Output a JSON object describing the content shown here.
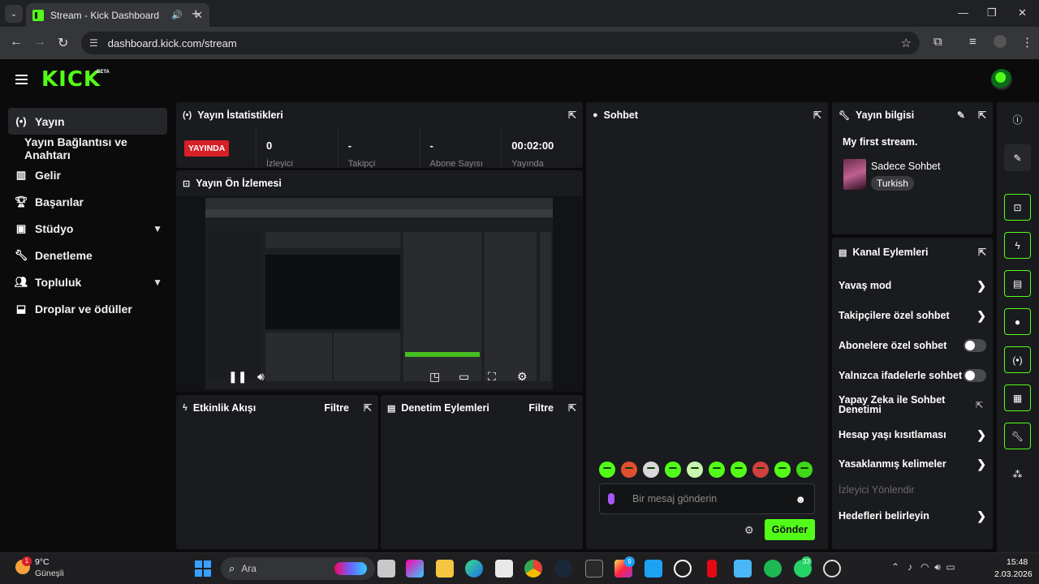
{
  "browser": {
    "tab_title": "Stream - Kick Dashboard",
    "url": "dashboard.kick.com/stream",
    "new_tab": "+",
    "tab_close": "✕"
  },
  "header": {
    "logo": "KICK",
    "beta": "BETA"
  },
  "sidebar": {
    "items": [
      {
        "label": "Yayın",
        "icon": "broadcast-icon"
      },
      {
        "label": "Yayın Bağlantısı ve Anahtarı",
        "icon": ""
      },
      {
        "label": "Gelir",
        "icon": "revenue-icon"
      },
      {
        "label": "Başarılar",
        "icon": "trophy-icon"
      },
      {
        "label": "Stüdyo",
        "icon": "studio-icon"
      },
      {
        "label": "Denetleme",
        "icon": "wrench-icon"
      },
      {
        "label": "Topluluk",
        "icon": "community-icon"
      },
      {
        "label": "Droplar ve ödüller",
        "icon": "drops-icon"
      }
    ]
  },
  "stats": {
    "title": "Yayın İstatistikleri",
    "live": "YAYINDA",
    "values": [
      "0",
      "-",
      "-",
      "00:02:00"
    ],
    "labels": [
      "İzleyici",
      "Takipçi",
      "Abone Sayısı",
      "Yayında"
    ]
  },
  "preview": {
    "title": "Yayın Ön İzlemesi"
  },
  "activity": {
    "title": "Etkinlik Akışı",
    "filter": "Filtre"
  },
  "moderation": {
    "title": "Denetim Eylemleri",
    "filter": "Filtre"
  },
  "chat": {
    "title": "Sohbet",
    "placeholder": "Bir mesaj gönderin",
    "send": "Gönder"
  },
  "info": {
    "title": "Yayın bilgisi",
    "stream_title": "My first stream.",
    "category": "Sadece Sohbet",
    "language": "Turkish"
  },
  "channel_actions": {
    "title": "Kanal Eylemleri",
    "items": [
      "Yavaş mod",
      "Takipçilere özel sohbet",
      "Abonelere özel sohbet",
      "Yalnızca ifadelerle sohbet",
      "Yapay Zeka ile Sohbet Denetimi",
      "Hesap yaşı kısıtlaması",
      "Yasaklanmış kelimeler",
      "İzleyici Yönlendir",
      "Hedefleri belirleyin"
    ]
  },
  "taskbar": {
    "weather_temp": "9°C",
    "weather_desc": "Güneşli",
    "weather_badge": "1",
    "search_label": "Ara",
    "instagram_badge": "9",
    "whatsapp_badge": "33",
    "time": "15:48",
    "date": "2.03.2026"
  },
  "colors": {
    "accent": "#53fc18",
    "live": "#d61f26",
    "panel": "#1a1b1e"
  }
}
